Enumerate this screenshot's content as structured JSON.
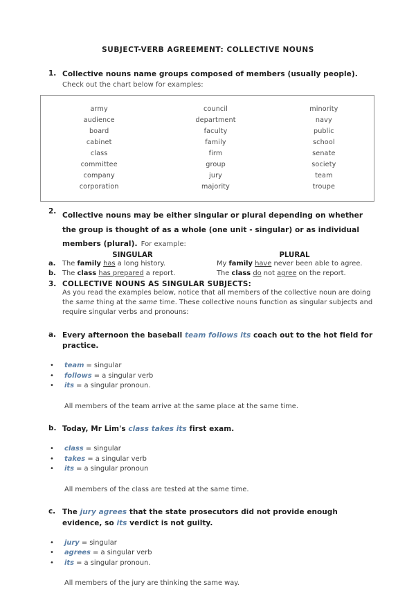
{
  "document": {
    "title": "SUBJECT-VERB AGREEMENT:  COLLECTIVE NOUNS"
  },
  "section1": {
    "number": "1.",
    "lead": "Collective nouns name groups composed of members (usually people).",
    "sub": "Check out the chart below for examples:",
    "table": {
      "rows": [
        [
          "army",
          "council",
          "minority"
        ],
        [
          "audience",
          "department",
          "navy"
        ],
        [
          "board",
          "faculty",
          "public"
        ],
        [
          "cabinet",
          "family",
          "school"
        ],
        [
          "class",
          "firm",
          "senate"
        ],
        [
          "committee",
          "group",
          "society"
        ],
        [
          "company",
          "jury",
          "team"
        ],
        [
          "corporation",
          "majority",
          "troupe"
        ]
      ]
    }
  },
  "section2": {
    "number": "2.",
    "lead": "Collective nouns may be either singular or plural depending on whether the group is thought of as a whole (one unit - singular) or as individual members (plural).",
    "sub": "For example:",
    "head_singular": "SINGULAR",
    "head_plural": "PLURAL",
    "rows": [
      {
        "label": "a.",
        "singular": {
          "pre": "The ",
          "bold": "family",
          "mid": " ",
          "underline": "has",
          "post": " a long history."
        },
        "plural": {
          "pre": "My ",
          "bold": "family",
          "mid": " ",
          "underline": "have",
          "post": " never been able to agree."
        }
      },
      {
        "label": "b.",
        "singular": {
          "pre": "The ",
          "bold": "class",
          "mid": " ",
          "underline": "has prepared",
          "post": " a report."
        },
        "plural": {
          "pre": "The ",
          "bold": "class",
          "mid": " ",
          "underline": "do",
          "post": " not ",
          "underline2": "agree",
          "post2": " on the report."
        }
      }
    ]
  },
  "section3": {
    "number": "3.",
    "heading": "COLLECTIVE NOUNS AS SINGULAR SUBJECTS:",
    "para_1": "As you read the examples below, notice that all members of the collective noun are doing the ",
    "para_em1": "same",
    "para_2": " thing at the ",
    "para_em2": "same",
    "para_3": " time.  These collective nouns function as singular subjects and require singular verbs and pronouns:",
    "examples": [
      {
        "label": "a.",
        "pre": "Every afternoon the baseball ",
        "highlight": "team follows its",
        "post": " coach out to the hot field for practice.",
        "defs": [
          {
            "term": "team",
            "rest": " = singular"
          },
          {
            "term": "follows",
            "rest": " = a singular verb"
          },
          {
            "term": "its",
            "rest": " = a singular pronoun."
          }
        ],
        "closing": "All members of the team arrive at the same place at the same time."
      },
      {
        "label": "b.",
        "pre": "Today, Mr Lim's ",
        "highlight": "class takes its",
        "post": " first exam.",
        "defs": [
          {
            "term": "class",
            "rest": " = singular"
          },
          {
            "term": "takes",
            "rest": " = a singular verb"
          },
          {
            "term": "its",
            "rest": " = a singular pronoun"
          }
        ],
        "closing": "All members of the class are tested at the same time."
      },
      {
        "label": "c.",
        "pre": "The ",
        "highlight": "jury agrees",
        "post": " that the state prosecutors did not provide enough evidence, so ",
        "highlight2": "its",
        "post2": " verdict is not guilty.",
        "defs": [
          {
            "term": "jury",
            "rest": " = singular"
          },
          {
            "term": "agrees",
            "rest": " = a singular verb"
          },
          {
            "term": "its",
            "rest": " = a singular pronoun."
          }
        ],
        "closing": "All members of the jury are thinking the same way."
      }
    ]
  },
  "colors": {
    "highlight_blue": "#5b7fa6",
    "body_text": "#3e3e3e",
    "heading_text": "#1e1e1e",
    "table_border": "#8f8f8f"
  },
  "icons": {
    "bullet": "•"
  }
}
